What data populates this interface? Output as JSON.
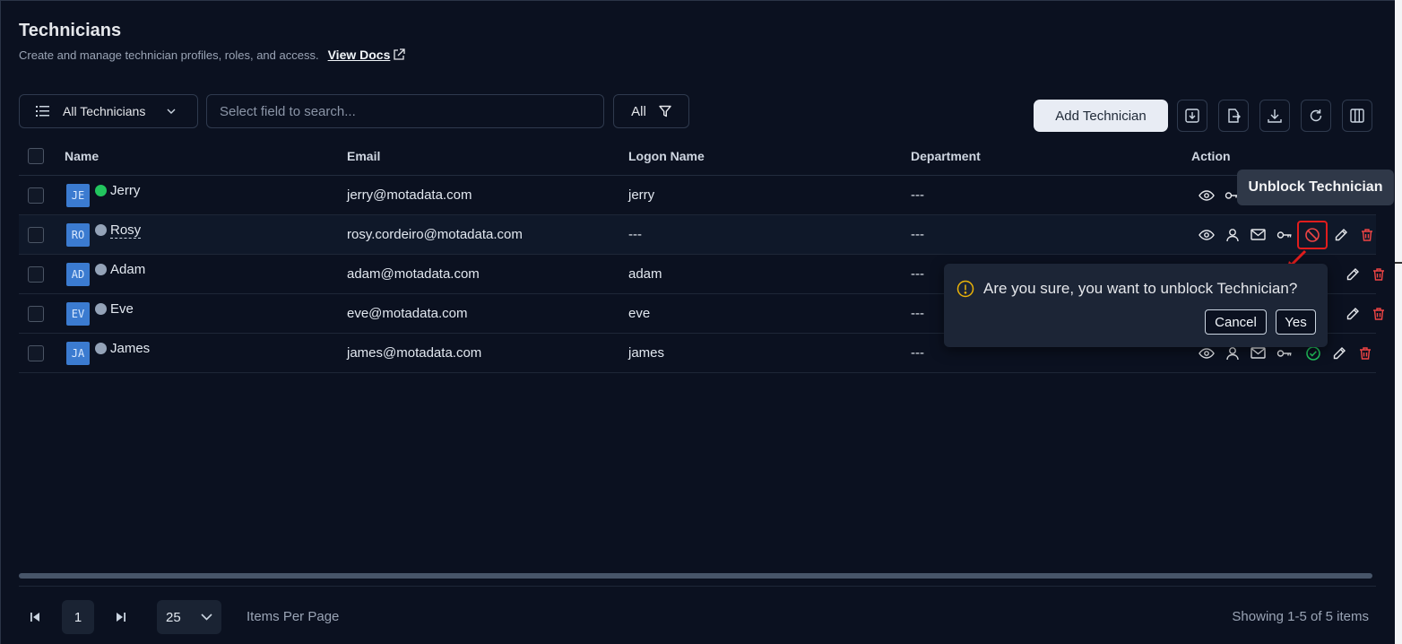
{
  "header": {
    "title": "Technicians",
    "subtitle": "Create and manage technician profiles, roles, and access.",
    "docs_link": "View Docs"
  },
  "toolbar": {
    "view_label": "All Technicians",
    "search_placeholder": "Select field to search...",
    "filter_label": "All",
    "add_label": "Add Technician",
    "icons": [
      "import-icon",
      "export-icon",
      "download-icon",
      "refresh-icon",
      "columns-icon"
    ]
  },
  "table": {
    "columns": [
      "Name",
      "Email",
      "Logon Name",
      "Department",
      "Action"
    ],
    "rows": [
      {
        "initials": "JE",
        "name": "Jerry",
        "online": true,
        "email": "jerry@motadata.com",
        "logon": "jerry",
        "department": "---"
      },
      {
        "initials": "RO",
        "name": "Rosy",
        "online": false,
        "email": "rosy.cordeiro@motadata.com",
        "logon": "---",
        "department": "---"
      },
      {
        "initials": "AD",
        "name": "Adam",
        "online": false,
        "email": "adam@motadata.com",
        "logon": "adam",
        "department": "---"
      },
      {
        "initials": "EV",
        "name": "Eve",
        "online": false,
        "email": "eve@motadata.com",
        "logon": "eve",
        "department": "---"
      },
      {
        "initials": "JA",
        "name": "James",
        "online": false,
        "email": "james@motadata.com",
        "logon": "james",
        "department": "---"
      }
    ]
  },
  "tooltip": {
    "text": "Unblock Technician"
  },
  "confirm": {
    "message": "Are you sure, you want to unblock Technician?",
    "cancel": "Cancel",
    "yes": "Yes"
  },
  "footer": {
    "page": "1",
    "page_size": "25",
    "items_per_page": "Items Per Page",
    "showing": "Showing 1-5 of 5 items"
  },
  "colors": {
    "background": "#0b1120",
    "primary_button": "#e8ecf4",
    "danger": "#e11d1d",
    "online": "#22c55e",
    "warning": "#eab308"
  }
}
